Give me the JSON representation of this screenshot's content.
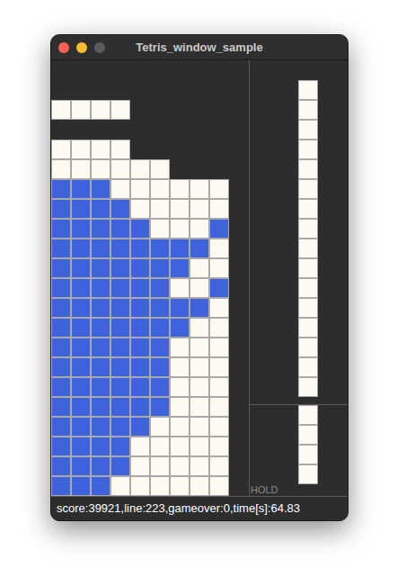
{
  "window": {
    "title": "Tetris_window_sample",
    "controls": [
      {
        "kind": "close",
        "color": "#ff5f57",
        "disabled": false
      },
      {
        "kind": "minimize",
        "color": "#febc2e",
        "disabled": false
      },
      {
        "kind": "zoom",
        "color": "#5b5b5b",
        "disabled": true
      }
    ]
  },
  "legend": [
    {
      "code": 0,
      "name": "empty",
      "color": "#2d2d2d"
    },
    {
      "code": 1,
      "name": "blue-block",
      "color": "#3e63dc"
    },
    {
      "code": 2,
      "name": "white-block",
      "color": "#fdfbf1"
    }
  ],
  "board": {
    "rows": [
      [
        0,
        0,
        0,
        0,
        0,
        0,
        0,
        0,
        0,
        0
      ],
      [
        0,
        0,
        0,
        0,
        0,
        0,
        0,
        0,
        0,
        0
      ],
      [
        2,
        2,
        2,
        2,
        0,
        0,
        0,
        0,
        0,
        0
      ],
      [
        0,
        0,
        0,
        0,
        0,
        0,
        0,
        0,
        0,
        0
      ],
      [
        2,
        2,
        2,
        2,
        0,
        0,
        0,
        0,
        0,
        0
      ],
      [
        2,
        2,
        2,
        2,
        2,
        2,
        0,
        0,
        0,
        0
      ],
      [
        1,
        1,
        1,
        2,
        2,
        2,
        2,
        2,
        2,
        0
      ],
      [
        1,
        1,
        1,
        1,
        2,
        2,
        2,
        2,
        2,
        0
      ],
      [
        1,
        1,
        1,
        1,
        1,
        2,
        2,
        2,
        1,
        0
      ],
      [
        1,
        1,
        1,
        1,
        1,
        1,
        1,
        1,
        2,
        0
      ],
      [
        1,
        1,
        1,
        1,
        1,
        1,
        1,
        2,
        2,
        0
      ],
      [
        1,
        1,
        1,
        1,
        1,
        1,
        2,
        2,
        1,
        0
      ],
      [
        1,
        1,
        1,
        1,
        1,
        1,
        1,
        1,
        2,
        0
      ],
      [
        1,
        1,
        1,
        1,
        1,
        1,
        1,
        2,
        2,
        0
      ],
      [
        1,
        1,
        1,
        1,
        1,
        1,
        2,
        2,
        2,
        0
      ],
      [
        1,
        1,
        1,
        1,
        1,
        1,
        2,
        2,
        2,
        0
      ],
      [
        1,
        1,
        1,
        1,
        1,
        1,
        2,
        2,
        2,
        0
      ],
      [
        1,
        1,
        1,
        1,
        1,
        1,
        2,
        2,
        2,
        0
      ],
      [
        1,
        1,
        1,
        1,
        1,
        2,
        2,
        2,
        2,
        0
      ],
      [
        1,
        1,
        1,
        1,
        2,
        2,
        2,
        2,
        2,
        0
      ],
      [
        1,
        1,
        1,
        1,
        2,
        2,
        2,
        2,
        2,
        0
      ],
      [
        1,
        1,
        1,
        2,
        2,
        2,
        2,
        2,
        2,
        0
      ]
    ]
  },
  "next": [
    {
      "shape": "I",
      "code": 2
    },
    {
      "shape": "I",
      "code": 2
    },
    {
      "shape": "I",
      "code": 2
    },
    {
      "shape": "I",
      "code": 2
    }
  ],
  "hold": {
    "label": "HOLD",
    "piece": {
      "shape": "I",
      "code": 2
    }
  },
  "status_bar": {
    "text": "score:39921,line:223,gameover:0,time[s]:64.83"
  }
}
